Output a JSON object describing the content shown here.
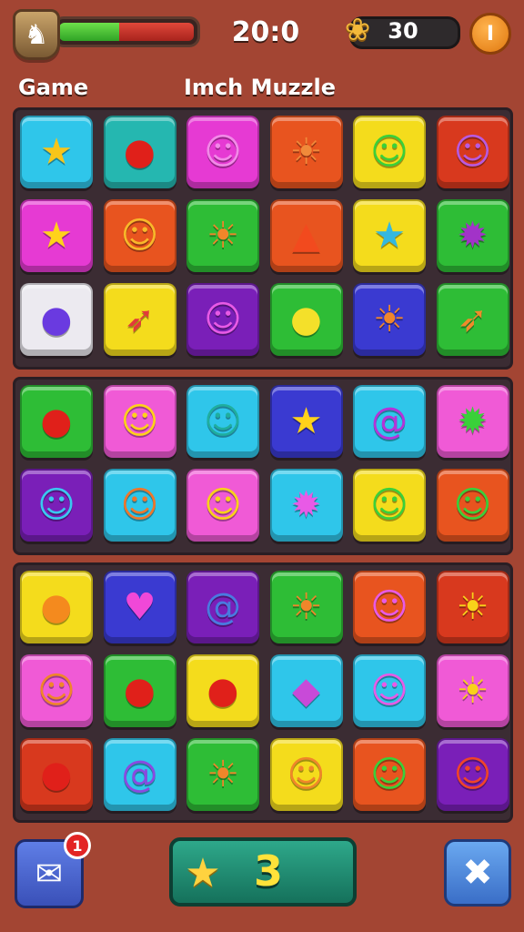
{
  "header": {
    "avatar_icon": "♞",
    "hp_percent": 45,
    "timer": "20:0",
    "coin_icon": "❀",
    "coins": "30",
    "pause_icon": "I"
  },
  "labels": {
    "game": "Game",
    "title": "Imch Muzzle"
  },
  "colors": {
    "cyan": "#2fc6ea",
    "teal": "#25b7b0",
    "magenta": "#e63ad3",
    "orange": "#e8541f",
    "yellow": "#f4dc1c",
    "green": "#2ebd36",
    "white": "#eceaf0",
    "purple": "#7a1fb8",
    "blue": "#3a3ad1",
    "pink": "#f05ad6",
    "red": "#d8391e"
  },
  "boards": [
    {
      "rows": [
        [
          {
            "color": "cyan",
            "icon": "star",
            "glyph": "★",
            "gc": "#f7c51a"
          },
          {
            "color": "teal",
            "icon": "apple",
            "glyph": "●",
            "gc": "#e0201a"
          },
          {
            "color": "magenta",
            "icon": "monster-face",
            "glyph": "☺",
            "gc": "#f28ae8"
          },
          {
            "color": "orange",
            "icon": "sun-face",
            "glyph": "☀",
            "gc": "#f08a3a"
          },
          {
            "color": "yellow",
            "icon": "green-blob",
            "glyph": "☺",
            "gc": "#3ad03a"
          },
          {
            "color": "red",
            "icon": "purple-monster",
            "glyph": "☺",
            "gc": "#b85ae0"
          }
        ],
        [
          {
            "color": "magenta",
            "icon": "star",
            "glyph": "★",
            "gc": "#ffd21a"
          },
          {
            "color": "orange",
            "icon": "face",
            "glyph": "☺",
            "gc": "#f8b82a"
          },
          {
            "color": "green",
            "icon": "sun-face",
            "glyph": "☀",
            "gc": "#f0862a"
          },
          {
            "color": "orange",
            "icon": "carrot",
            "glyph": "▲",
            "gc": "#f24a1e"
          },
          {
            "color": "yellow",
            "icon": "star",
            "glyph": "★",
            "gc": "#33b8e0"
          },
          {
            "color": "green",
            "icon": "purple-star",
            "glyph": "✹",
            "gc": "#a233c8"
          }
        ],
        [
          {
            "color": "white",
            "icon": "purple-blob",
            "glyph": "●",
            "gc": "#6a3ae0"
          },
          {
            "color": "yellow",
            "icon": "rocket",
            "glyph": "➶",
            "gc": "#e23a3a"
          },
          {
            "color": "purple",
            "icon": "pink-monster",
            "glyph": "☺",
            "gc": "#e85ae6"
          },
          {
            "color": "green",
            "icon": "yellow-bird",
            "glyph": "●",
            "gc": "#f4e02a"
          },
          {
            "color": "blue",
            "icon": "sun-face",
            "glyph": "☀",
            "gc": "#f0862a"
          },
          {
            "color": "green",
            "icon": "feather",
            "glyph": "➶",
            "gc": "#f08a2a"
          }
        ]
      ]
    },
    {
      "rows": [
        [
          {
            "color": "green",
            "icon": "apple",
            "glyph": "●",
            "gc": "#e0201a"
          },
          {
            "color": "pink",
            "icon": "yellow-ghost",
            "glyph": "☺",
            "gc": "#ffd21a"
          },
          {
            "color": "cyan",
            "icon": "teal-monster",
            "glyph": "☺",
            "gc": "#1fae9e"
          },
          {
            "color": "blue",
            "icon": "star",
            "glyph": "★",
            "gc": "#ffd21a"
          },
          {
            "color": "cyan",
            "icon": "purple-swirl",
            "glyph": "@",
            "gc": "#b533d8"
          },
          {
            "color": "pink",
            "icon": "green-star",
            "glyph": "✹",
            "gc": "#3ad03a"
          }
        ],
        [
          {
            "color": "purple",
            "icon": "blue-blob",
            "glyph": "☺",
            "gc": "#3ac8f0"
          },
          {
            "color": "cyan",
            "icon": "orange-monster",
            "glyph": "☺",
            "gc": "#f0762a"
          },
          {
            "color": "pink",
            "icon": "yellow-monster",
            "glyph": "☺",
            "gc": "#f8d21a"
          },
          {
            "color": "cyan",
            "icon": "pink-star",
            "glyph": "✹",
            "gc": "#e85ae6"
          },
          {
            "color": "yellow",
            "icon": "green-blob",
            "glyph": "☺",
            "gc": "#3ad03a"
          },
          {
            "color": "orange",
            "icon": "green-ghost",
            "glyph": "☺",
            "gc": "#3ad03a"
          }
        ]
      ]
    },
    {
      "rows": [
        [
          {
            "color": "yellow",
            "icon": "orange-fruit",
            "glyph": "●",
            "gc": "#f48a1e"
          },
          {
            "color": "blue",
            "icon": "heart",
            "glyph": "♥",
            "gc": "#f048d8"
          },
          {
            "color": "purple",
            "icon": "swirl",
            "glyph": "@",
            "gc": "#4a7ae0"
          },
          {
            "color": "green",
            "icon": "sun-face",
            "glyph": "☀",
            "gc": "#f0862a"
          },
          {
            "color": "orange",
            "icon": "pink-monster",
            "glyph": "☺",
            "gc": "#e85ae6"
          },
          {
            "color": "red",
            "icon": "yellow-sun",
            "glyph": "☀",
            "gc": "#f8d21a"
          }
        ],
        [
          {
            "color": "pink",
            "icon": "orange-monster",
            "glyph": "☺",
            "gc": "#f0862a"
          },
          {
            "color": "green",
            "icon": "apple",
            "glyph": "●",
            "gc": "#e0201a"
          },
          {
            "color": "yellow",
            "icon": "tomato",
            "glyph": "●",
            "gc": "#e0201a"
          },
          {
            "color": "cyan",
            "icon": "shell",
            "glyph": "◆",
            "gc": "#c84ad8"
          },
          {
            "color": "cyan",
            "icon": "pink-blob",
            "glyph": "☺",
            "gc": "#e85ae6"
          },
          {
            "color": "pink",
            "icon": "yellow-sun",
            "glyph": "☀",
            "gc": "#f8d21a"
          }
        ],
        [
          {
            "color": "red",
            "icon": "tomato",
            "glyph": "●",
            "gc": "#e0201a"
          },
          {
            "color": "cyan",
            "icon": "purple-swirl",
            "glyph": "@",
            "gc": "#8a4ae0"
          },
          {
            "color": "green",
            "icon": "sun-face",
            "glyph": "☀",
            "gc": "#f0862a"
          },
          {
            "color": "yellow",
            "icon": "orange-face",
            "glyph": "☺",
            "gc": "#f0862a"
          },
          {
            "color": "orange",
            "icon": "green-blob",
            "glyph": "☺",
            "gc": "#3ad03a"
          },
          {
            "color": "purple",
            "icon": "red-monster",
            "glyph": "☺",
            "gc": "#f0442a"
          }
        ]
      ]
    }
  ],
  "footer": {
    "chat_icon": "✉",
    "chat_badge": "1",
    "star_icon": "★",
    "moves": "3",
    "close_icon": "✖"
  }
}
